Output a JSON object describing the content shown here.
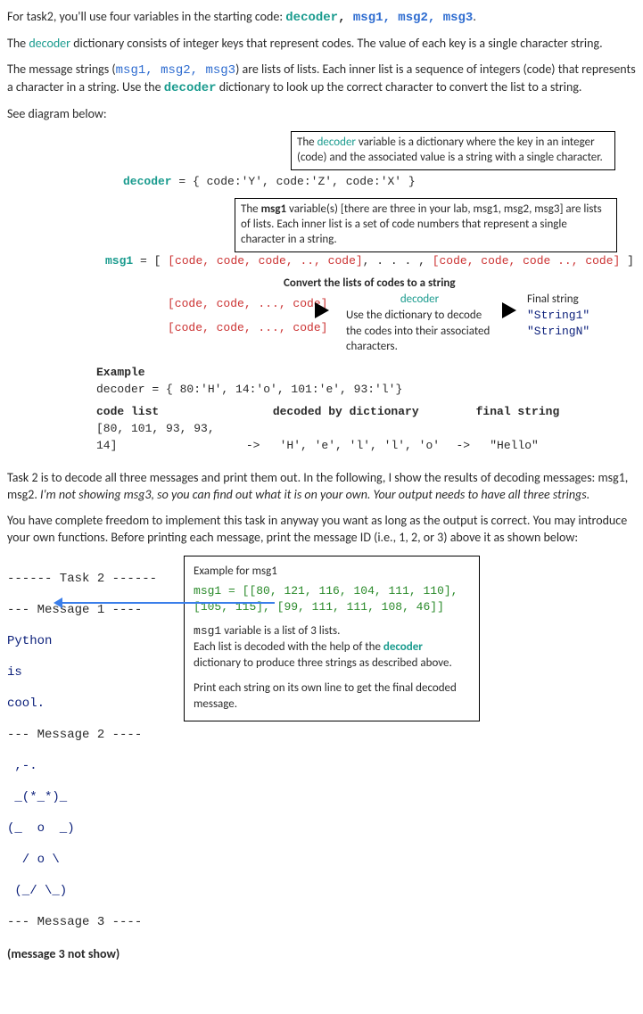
{
  "intro": {
    "p1a": "For task2, you'll use four variables in the starting code: ",
    "p1b": "decoder",
    "p1c": ", ",
    "p1d": "msg1, msg2, msg3",
    "p1e": ".",
    "p2a": "The ",
    "p2b": "decoder",
    "p2c": " dictionary consists of integer keys that represent codes.  The value of each key is a single character string.",
    "p3a": "The message strings (",
    "p3b": "msg1, msg2, msg3",
    "p3c": ") are lists of lists.  Each inner list is a sequence of integers (code) that represents a character in a string.  Use the ",
    "p3d": "decoder",
    "p3e": "  dictionary to look up the correct character to convert the list to a string.",
    "p4": "See diagram below:"
  },
  "dia": {
    "box1a": "The ",
    "box1b": "decoder",
    "box1c": " variable is a dictionary where the key in an integer (code) and the associated value is a string with a single character.",
    "decl1a": "decoder",
    "decl1b": " = { ",
    "decl1c": "code:'Y'",
    "decl1d": ", ",
    "decl1e": "code:'Z'",
    "decl1f": ", ",
    "decl1g": "code:'X'",
    "decl1h": " }",
    "box2a": "The ",
    "box2b": "msg1",
    "box2c": " variable(s) [there are three in your lab, msg1, msg2, msg3] are lists of lists.   Each inner list is a set of code numbers that represent a single character in a string.",
    "msg1a": "msg1",
    "msg1b": " = [  ",
    "msg1c": "[code, code, code, .., code]",
    "msg1d": ",  . . . ,   ",
    "msg1e": "[code, code, code .., code]",
    "msg1f": "  ]",
    "conv_title": "Convert the lists of codes to a string",
    "cl1": "[code, code, ..., code]",
    "cl2": "[code, code, ..., code]",
    "dec_h": "decoder",
    "dec_t": "Use the dictionary to decode the codes into their associated characters.",
    "fs": "Final string",
    "s1": "\"String1\"",
    "sn": "\"StringN\"",
    "ex": "Example",
    "exd": "decoder = { 80:'H', 14:'o', 101:'e', 93:'l'}",
    "clh": "code list",
    "cll": "[80, 101, 93, 93, 14]",
    "ddh": "decoded by dictionary",
    "ddl": "'H', 'e', 'l', 'l', 'o'",
    "fsh": "final string",
    "fsl": "\"Hello\"",
    "arw": "->"
  },
  "mid": {
    "p1": "Task 2 is to decode all three messages and print them out.  In the following, I show the results of decoding messages: msg1, msg2.  ",
    "p1i": "I'm not showing msg3, so you can find out what it is on your own. Your output needs to have all three strings.",
    "p2": "You have complete freedom to implement this task in anyway you want as long as the output is correct.   You may introduce your own functions.   Before printing each message, print the message ID (i.e., 1, 2, or 3) above it as shown below:"
  },
  "out": {
    "t2": "------ Task 2 ------",
    "m1": "--- Message 1 ----",
    "py1": "Python",
    "py2": "is",
    "py3": "cool.",
    "m2": "--- Message 2 ----",
    "a1": " ,-.",
    "a2": " _(*_*)_",
    "a3": "(_  o  _)",
    "a4": "  / o \\",
    "a5": " (_/ \\_)",
    "m3": "--- Message 3 ----",
    "ns": "(message 3 not show)"
  },
  "rb": {
    "t1": "Example for msg1",
    "c1": "msg1 = [[80, 121, 116, 104, 111, 110], [105, 115], [99, 111, 111, 108, 46]]",
    "l1a": "msg1",
    "l1b": "  variable is a list of 3 lists.",
    "l2a": "Each list is decoded with the help of the ",
    "l2b": "decoder",
    "l2c": " dictionary to produce three strings as described above.",
    "l3": "Print each string on its own line to get the final decoded message."
  }
}
